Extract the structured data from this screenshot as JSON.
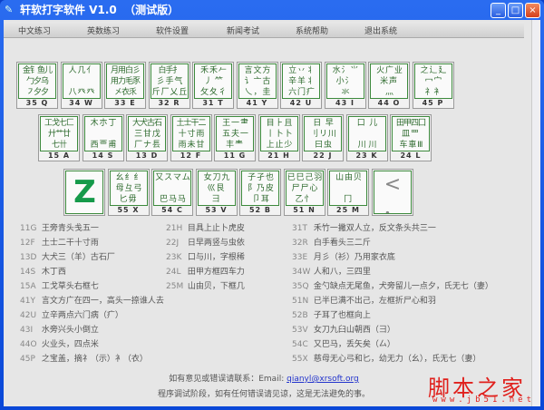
{
  "window": {
    "title": "轩软打字软件 V1.0  （测试版）",
    "minimize": "_",
    "maximize": "□",
    "close": "×"
  },
  "menu": [
    "中文练习",
    "英数练习",
    "软件设置",
    "新闻考试",
    "系统帮助",
    "退出系统"
  ],
  "keys": {
    "row1": [
      {
        "roots": "金钅鱼儿\n勹夕乌\n㇇夕夕",
        "code": "35 Q"
      },
      {
        "roots": "人 几 亻\n\n八 癶 癶",
        "code": "34 W"
      },
      {
        "roots": "月用白彡\n用力毛豕\n㐅衣乑",
        "code": "33 E"
      },
      {
        "roots": "白手扌\n彡 手 气\n斤 厂 乂 丘",
        "code": "32 R"
      },
      {
        "roots": "禾 禾 𠂉\n丿  ⺮\n攵 夂 彳",
        "code": "31 T"
      },
      {
        "roots": "言 文 方\n讠 亠 古\n乀 ， 圭",
        "code": "41 Y"
      },
      {
        "roots": "立 丷 丬\n辛 羊 丬\n六 门 疒",
        "code": "42 U"
      },
      {
        "roots": "水 氵 ⺌\n小 氵 \n 氺 ",
        "code": "43 I"
      },
      {
        "roots": "火 广 业\n米 声 \n 灬 ",
        "code": "44 O"
      },
      {
        "roots": "之 辶 廴\n冖 宀\n礻 衤",
        "code": "45 P"
      }
    ],
    "row2": [
      {
        "roots": "工戈七匚\n廾艹廿\n七卄",
        "code": "15 A"
      },
      {
        "roots": "木 朩 丁\n\n西 覀 甫",
        "code": "14 S"
      },
      {
        "roots": "大犬古石\n三 甘 戊\n厂 ナ 镸",
        "code": "13 D"
      },
      {
        "roots": "土士干二\n十 寸 雨\n雨 未 甘",
        "code": "12 F"
      },
      {
        "roots": "王 一 ⺻\n五 夫 一\n丰 龶 ",
        "code": "11 G"
      },
      {
        "roots": "目 ⺊ 且\n丨 卜 卜\n上 止 少",
        "code": "21 H"
      },
      {
        "roots": "日   早\n刂 リ 川\n曰 虫",
        "code": "22 J"
      },
      {
        "roots": "口   儿\n\n川  川",
        "code": "23 K"
      },
      {
        "roots": "田甲四囗\n皿 罒 \n车 車 Ⅲ",
        "code": "24 L"
      }
    ],
    "row3": [
      {
        "roots": "Z",
        "code": ""
      },
      {
        "roots": "幺 纟 纟\n母 彑 弓\n匕 毋 ",
        "code": "55 X"
      },
      {
        "roots": "又 ス マ ム\n\n巴 马 马",
        "code": "54 C"
      },
      {
        "roots": "女 刀 九\n巛 艮 \n彐 ",
        "code": "53 V"
      },
      {
        "roots": "子 孑 也\n阝 乃 皮\n卩 耳",
        "code": "52 B"
      },
      {
        "roots": "已 巳 己 羽\n尸 尸 心\n乙 忄 ",
        "code": "51 N"
      },
      {
        "roots": "山 由 贝\n\n冂 ",
        "code": "25 M"
      },
      {
        "roots": "<\n，",
        "code": ""
      }
    ]
  },
  "list_left": [
    {
      "code": "11G",
      "text": "王旁青头戋五一"
    },
    {
      "code": "12F",
      "text": "土士二干十寸雨"
    },
    {
      "code": "13D",
      "text": "大犬三（羊）古石厂"
    },
    {
      "code": "14S",
      "text": "木丁西"
    },
    {
      "code": "15A",
      "text": "工戈草头右框七"
    },
    {
      "code": "41Y",
      "text": "言文方广在四一，高头一捺谁人去"
    },
    {
      "code": "42U",
      "text": "立辛两点六门病（疒）"
    },
    {
      "code": "43I",
      "text": "水旁兴头小倒立"
    },
    {
      "code": "44O",
      "text": "火业头，四点米"
    },
    {
      "code": "45P",
      "text": "之宝盖，摘礻（示）衤（衣）"
    }
  ],
  "list_mid": [
    {
      "code": "21H",
      "text": "目具上止卜虎皮"
    },
    {
      "code": "22J",
      "text": "日早两竖与虫依"
    },
    {
      "code": "23K",
      "text": "口与川，字根稀"
    },
    {
      "code": "24L",
      "text": "田甲方框四车力"
    },
    {
      "code": "25M",
      "text": "山由贝，下框几"
    }
  ],
  "list_right": [
    {
      "code": "31T",
      "text": "禾竹一撇双人立，反文条头共三一"
    },
    {
      "code": "32R",
      "text": "白手看头三二斤"
    },
    {
      "code": "33E",
      "text": "月彡（衫）乃用家衣底"
    },
    {
      "code": "34W",
      "text": "人和八，三四里"
    },
    {
      "code": "35Q",
      "text": "金勺缺点无尾鱼，犬旁留儿一点夕，氏无七（妻）"
    },
    {
      "code": "51N",
      "text": "已半巳满不出己，左框折尸心和羽"
    },
    {
      "code": "52B",
      "text": "子耳了也框向上"
    },
    {
      "code": "53V",
      "text": "女刀九臼山朝西（彐）"
    },
    {
      "code": "54C",
      "text": "又巴马，丢矢矣（厶）"
    },
    {
      "code": "55X",
      "text": "慈母无心弓和匕，幼无力（幺），氏无七（妻）"
    }
  ],
  "footer": {
    "contact": "如有意见或错误请联系：Email:",
    "email": "qianyl@xrsoft.org",
    "notice": "程序调试阶段，如有任何错误请见谅，这是无法避免的事。"
  },
  "watermark": {
    "name": "脚本之家",
    "url": "www.jb51.net"
  }
}
